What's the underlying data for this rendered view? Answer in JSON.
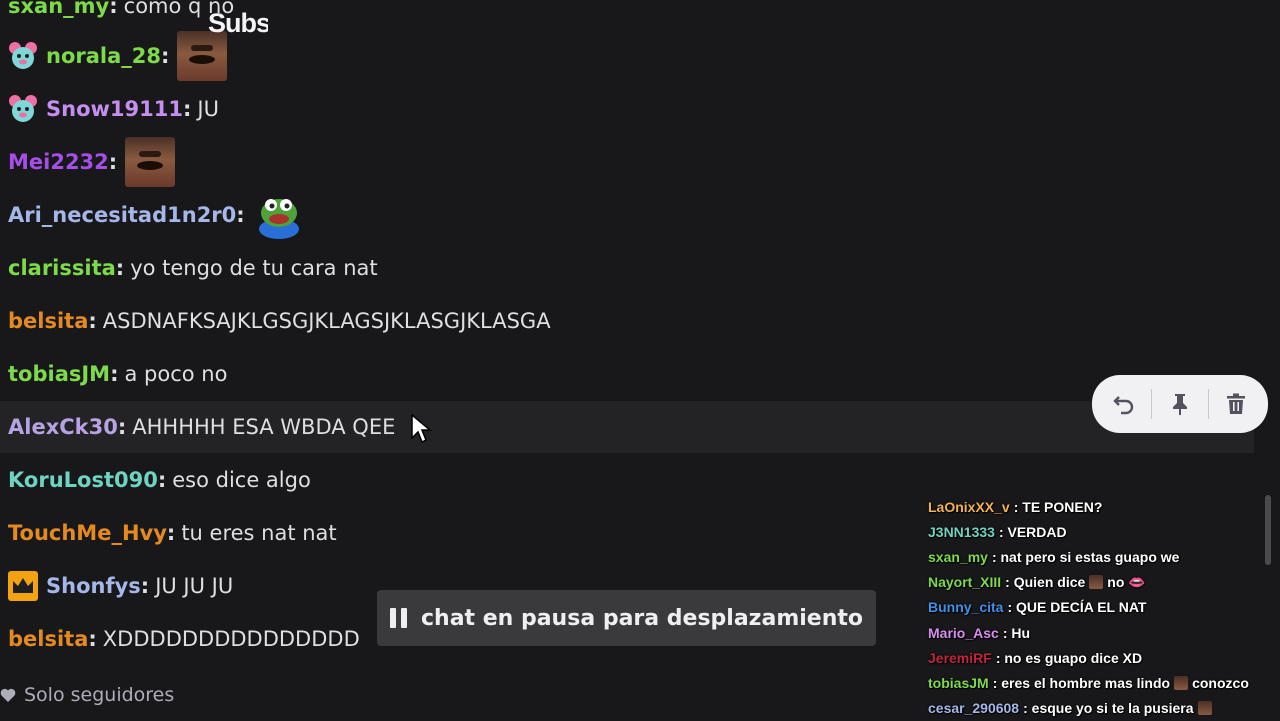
{
  "overlay_text": "Subs",
  "colors": {
    "bg": "#18181b",
    "highlight_row": "#232326",
    "mod_tools_bg": "#f1f1f3",
    "pause_banner_bg": "#3a3a3d"
  },
  "messages": [
    {
      "user": "sxan_my",
      "color": "#7ddb4a",
      "text": "como q no",
      "badge": null,
      "emote": null
    },
    {
      "user": "norala_28",
      "color": "#7ddb4a",
      "text": "",
      "badge": "pink-bear-badge",
      "emote": "laughing-face-emote"
    },
    {
      "user": "Snow19111",
      "color": "#c58ef0",
      "text": "JU",
      "badge": "pink-bear-badge",
      "emote": null
    },
    {
      "user": "Mei2232",
      "color": "#a64ee8",
      "text": "",
      "badge": null,
      "emote": "laughing-face-emote"
    },
    {
      "user": "Ari_necesitad1n2r0",
      "color": "#a5b7e8",
      "text": "",
      "badge": null,
      "emote": "pepe-emote"
    },
    {
      "user": "clarissita",
      "color": "#7ddb4a",
      "text": "yo tengo de tu cara nat",
      "badge": null,
      "emote": null
    },
    {
      "user": "belsita",
      "color": "#e58a1e",
      "text": "ASDNAFKSAJKLGSGJKLAGSJKLASGJKLASGA",
      "badge": null,
      "emote": null
    },
    {
      "user": "tobiasJM",
      "color": "#7ddb4a",
      "text": "a poco no",
      "badge": null,
      "emote": null
    },
    {
      "user": "AlexCk30",
      "color": "#b7a3e3",
      "text": "AHHHHH ESA WBDA QEE",
      "badge": null,
      "emote": null
    },
    {
      "user": "KoruLost090",
      "color": "#6fd3c1",
      "text": "eso dice algo",
      "badge": null,
      "emote": null
    },
    {
      "user": "TouchMe_Hvy",
      "color": "#e58a1e",
      "text": "tu eres nat nat",
      "badge": null,
      "emote": null
    },
    {
      "user": "Shonfys",
      "color": "#a5b7e8",
      "text": "JU JU JU",
      "badge": "crown-badge",
      "emote": null
    },
    {
      "user": "belsita",
      "color": "#e58a1e",
      "text": "XDDDDDDDDDDDDDDD",
      "badge": null,
      "emote": null
    }
  ],
  "mod_tools": {
    "undo_icon": "undo-icon",
    "pin_icon": "pin-icon",
    "delete_icon": "trash-icon"
  },
  "pause_banner": {
    "label": "chat en pausa para desplazamiento"
  },
  "chat_mode": {
    "label": "Solo seguidores"
  },
  "overlay_chat": [
    {
      "user": "LaOnixXX_v",
      "color": "#f3b24e",
      "text": "TE PONEN?"
    },
    {
      "user": "J3NN1333",
      "color": "#6fd3c1",
      "text": "VERDAD"
    },
    {
      "user": "sxan_my",
      "color": "#7ddb4a",
      "text": "nat pero si estas guapo we"
    },
    {
      "user": "Nayort_XIII",
      "color": "#7ddb4a",
      "text_before": "Quien dice",
      "text_after": "no",
      "emote": true,
      "lips": true
    },
    {
      "user": "Bunny_cita",
      "color": "#3f8fe8",
      "text": "QUE DECÍA EL NAT"
    },
    {
      "user": "Mario_Asc",
      "color": "#d98cf0",
      "text": "Hu"
    },
    {
      "user": "JeremiRF",
      "color": "#c1263c",
      "text": "no es guapo dice XD"
    },
    {
      "user": "tobiasJM",
      "color": "#7ddb4a",
      "text_before": "eres el hombre mas lindo",
      "text_after": "conozco",
      "emote": true
    },
    {
      "user": "cesar_290608",
      "color": "#a5b7e8",
      "text_before": "esque yo si te la pusiera",
      "text_after": "",
      "emote": true
    }
  ]
}
